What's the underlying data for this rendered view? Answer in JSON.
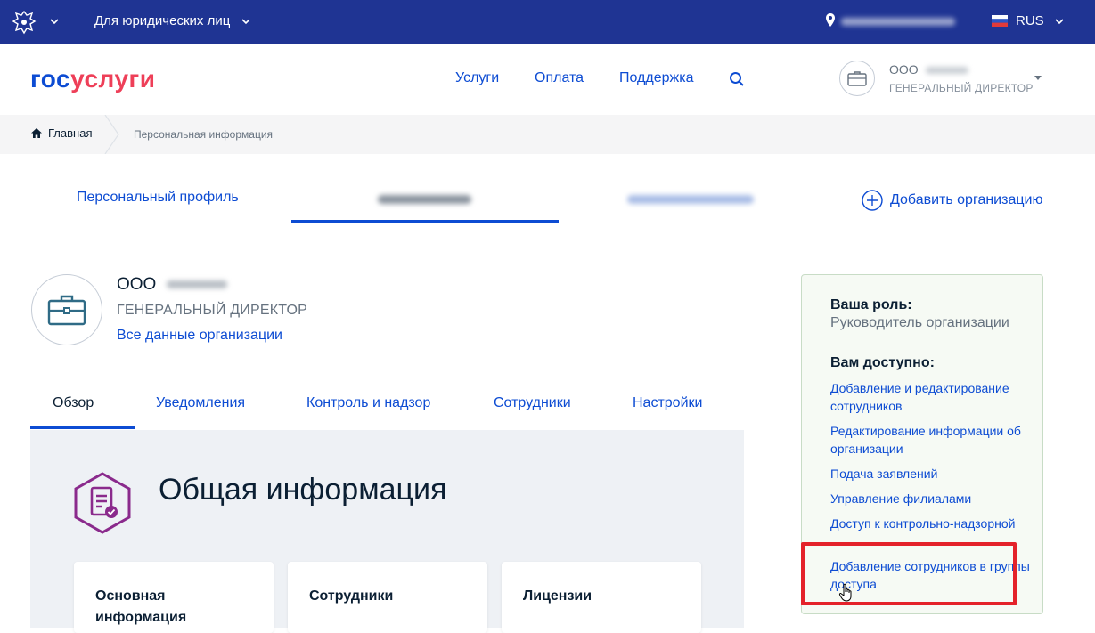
{
  "topbar": {
    "legal_entities_label": "Для юридических лиц",
    "language": "RUS"
  },
  "header": {
    "logo_part1": "гос",
    "logo_part2": "услуги",
    "nav": [
      "Услуги",
      "Оплата",
      "Поддержка"
    ],
    "org_name": "ООО",
    "org_role": "ГЕНЕРАЛЬНЫЙ ДИРЕКТОР"
  },
  "breadcrumb": {
    "home": "Главная",
    "current": "Персональная информация"
  },
  "profile_tabs": {
    "personal": "Персональный профиль",
    "add_org": "Добавить организацию"
  },
  "org": {
    "title": "ООО",
    "position": "ГЕНЕРАЛЬНЫЙ ДИРЕКТОР",
    "all_data_link": "Все данные организации"
  },
  "tabs": [
    "Обзор",
    "Уведомления",
    "Контроль и надзор",
    "Сотрудники",
    "Настройки"
  ],
  "panel": {
    "title": "Общая информация",
    "cards": [
      "Основная информация",
      "Сотрудники",
      "Лицензии"
    ]
  },
  "role_box": {
    "role_heading": "Ваша роль:",
    "role_value": "Руководитель организации",
    "available_heading": "Вам доступно:",
    "links": [
      "Добавление и редактирование сотрудников",
      "Редактирование информации об организации",
      "Подача заявлений",
      "Управление филиалами",
      "Доступ к контрольно-надзорной деятельности",
      "Добавление сотрудников в группы доступа"
    ]
  },
  "colors": {
    "topbar_bg": "#1f3493",
    "link": "#0d4cd3",
    "logo_red": "#ee3f58",
    "highlight": "#e4222a"
  }
}
